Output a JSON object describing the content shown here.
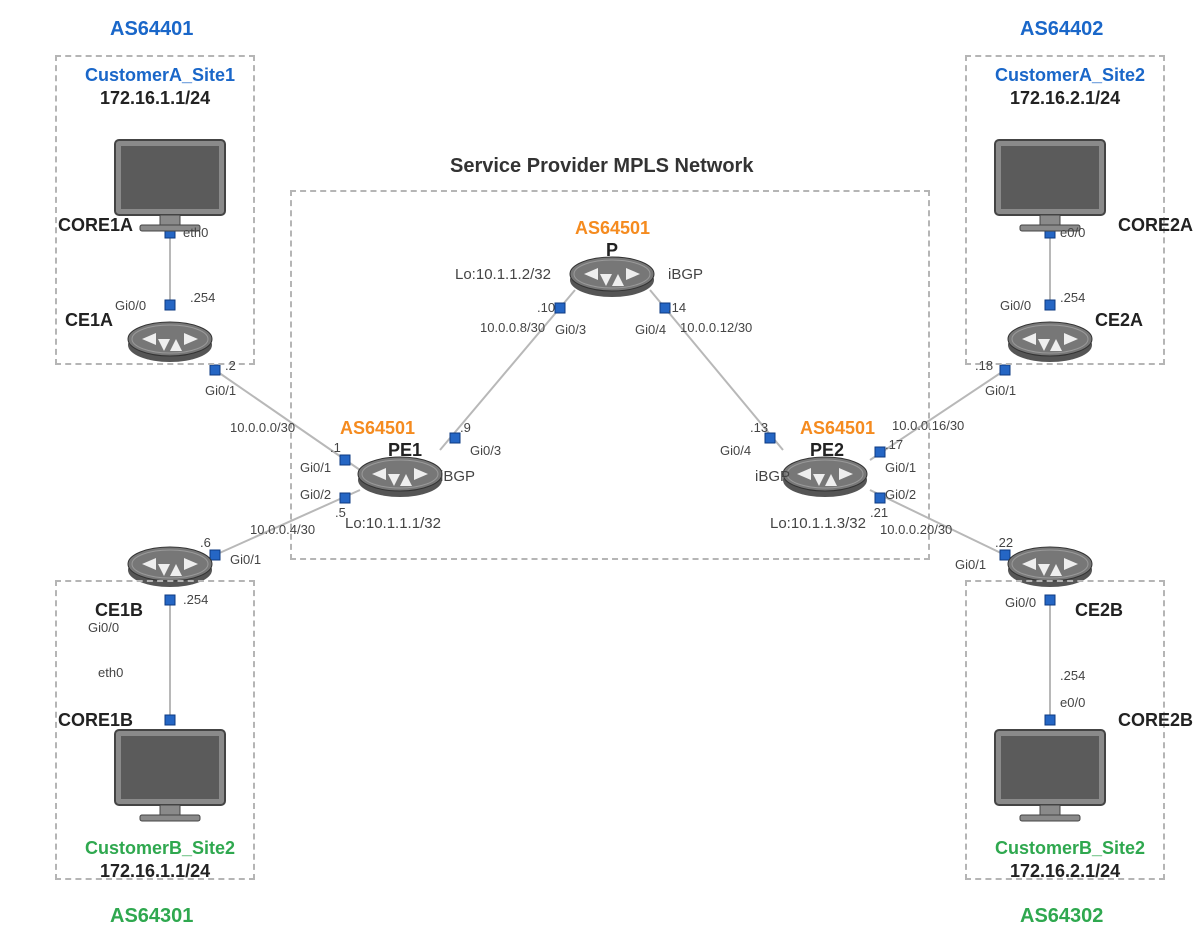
{
  "title": "Service Provider MPLS Network",
  "as": {
    "tl": "AS64401",
    "tr": "AS64402",
    "bl": "AS64301",
    "br": "AS64302",
    "pe1": "AS64501",
    "p": "AS64501",
    "pe2": "AS64501"
  },
  "customer": {
    "a1_name": "CustomerA_Site1",
    "a1_ip": "172.16.1.1/24",
    "a2_name": "CustomerA_Site2",
    "a2_ip": "172.16.2.1/24",
    "b1_name": "CustomerB_Site2",
    "b1_ip": "172.16.1.1/24",
    "b2_name": "CustomerB_Site2",
    "b2_ip": "172.16.2.1/24"
  },
  "nodes": {
    "core1a": "CORE1A",
    "core2a": "CORE2A",
    "core1b": "CORE1B",
    "core2b": "CORE2B",
    "ce1a": "CE1A",
    "ce2a": "CE2A",
    "ce1b": "CE1B",
    "ce2b": "CE2B",
    "pe1": "PE1",
    "pe2": "PE2",
    "p": "P"
  },
  "loopbacks": {
    "pe1": "Lo:10.1.1.1/32",
    "p": "Lo:10.1.1.2/32",
    "pe2": "Lo:10.1.1.3/32"
  },
  "ibgp": "iBGP",
  "ports": {
    "eth0": "eth0",
    "e00": "e0/0",
    "gi00": "Gi0/0",
    "gi01": "Gi0/1",
    "gi02": "Gi0/2",
    "gi03": "Gi0/3",
    "gi04": "Gi0/4"
  },
  "subnets": {
    "ce1a_pe1": "10.0.0.0/30",
    "ce1b_pe1": "10.0.0.4/30",
    "pe1_p": "10.0.0.8/30",
    "p_pe2": "10.0.0.12/30",
    "pe2_ce2a": "10.0.0.16/30",
    "pe2_ce2b": "10.0.0.20/30"
  },
  "hosts": {
    "h254": ".254",
    "h2": ".2",
    "h1": ".1",
    "h6": ".6",
    "h5": ".5",
    "h9": ".9",
    "h10": ".10",
    "h13": ".13",
    "h14": ".14",
    "h17": ".17",
    "h18": ".18",
    "h21": ".21",
    "h22": ".22"
  }
}
